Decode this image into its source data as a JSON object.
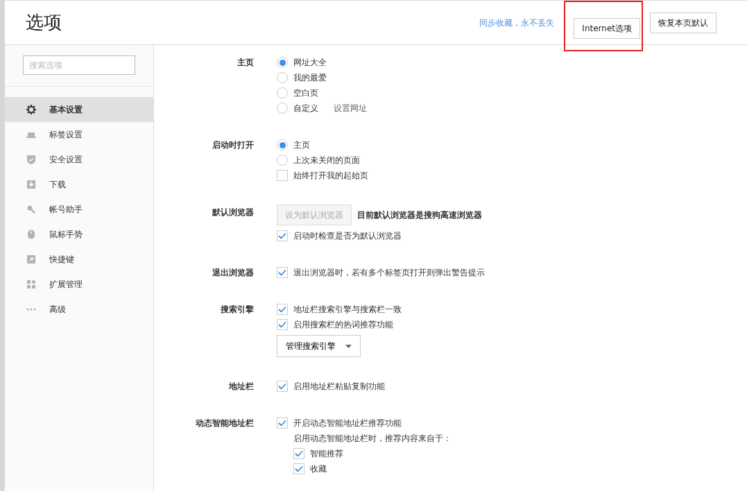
{
  "header": {
    "title": "选项",
    "sync_link": "同步收藏，永不丢失",
    "buttons": [
      {
        "label": "Internet选项",
        "highlighted": true
      },
      {
        "label": "恢复本页默认",
        "highlighted": false
      }
    ]
  },
  "sidebar": {
    "search": {
      "placeholder": "搜索选项"
    },
    "items": [
      {
        "label": "基本设置",
        "selected": true
      },
      {
        "label": "标签设置",
        "selected": false
      },
      {
        "label": "安全设置",
        "selected": false
      },
      {
        "label": "下载",
        "selected": false
      },
      {
        "label": "帐号助手",
        "selected": false
      },
      {
        "label": "鼠标手势",
        "selected": false
      },
      {
        "label": "快捷键",
        "selected": false
      },
      {
        "label": "扩展管理",
        "selected": false
      },
      {
        "label": "高级",
        "selected": false
      }
    ]
  },
  "sections": [
    {
      "label": "主页",
      "items": [
        {
          "kind": "radio",
          "label": "网址大全",
          "selected": true
        },
        {
          "kind": "radio",
          "label": "我的最爱",
          "selected": false
        },
        {
          "kind": "radio",
          "label": "空白页",
          "selected": false
        },
        {
          "kind": "radio",
          "label": "自定义",
          "selected": false,
          "link": "设置网址"
        }
      ]
    },
    {
      "label": "启动时打开",
      "items": [
        {
          "kind": "radio",
          "label": "主页",
          "selected": true
        },
        {
          "kind": "radio",
          "label": "上次未关闭的页面",
          "selected": false
        },
        {
          "kind": "checkbox",
          "label": "始终打开我的起始页",
          "checked": false
        }
      ]
    },
    {
      "label": "默认浏览器",
      "items": [
        {
          "kind": "button",
          "label": "设为默认浏览器",
          "disabled": true,
          "note": "目前默认浏览器是搜狗高速浏览器"
        },
        {
          "kind": "checkbox",
          "label": "启动时检查是否为默认浏览器",
          "checked": true
        }
      ]
    },
    {
      "label": "退出浏览器",
      "items": [
        {
          "kind": "checkbox",
          "label": "退出浏览器时，若有多个标签页打开则弹出警告提示",
          "checked": true
        }
      ]
    },
    {
      "label": "搜索引擎",
      "items": [
        {
          "kind": "checkbox",
          "label": "地址栏搜索引擎与搜索栏一致",
          "checked": true
        },
        {
          "kind": "checkbox",
          "label": "启用搜索栏的热词推荐功能",
          "checked": true
        },
        {
          "kind": "dropdown",
          "label": "管理搜索引擎"
        }
      ]
    },
    {
      "label": "地址栏",
      "items": [
        {
          "kind": "checkbox",
          "label": "启用地址栏粘贴复制功能",
          "checked": true
        }
      ]
    },
    {
      "label": "动态智能地址栏",
      "items": [
        {
          "kind": "checkbox",
          "label": "开启动态智能地址栏推荐功能",
          "checked": true,
          "children": [
            {
              "kind": "note",
              "label": "启用动态智能地址栏时，推荐内容来自于："
            },
            {
              "kind": "checkbox",
              "label": "智能推荐",
              "checked": true
            },
            {
              "kind": "checkbox",
              "label": "收藏",
              "checked": true
            }
          ]
        }
      ]
    }
  ]
}
